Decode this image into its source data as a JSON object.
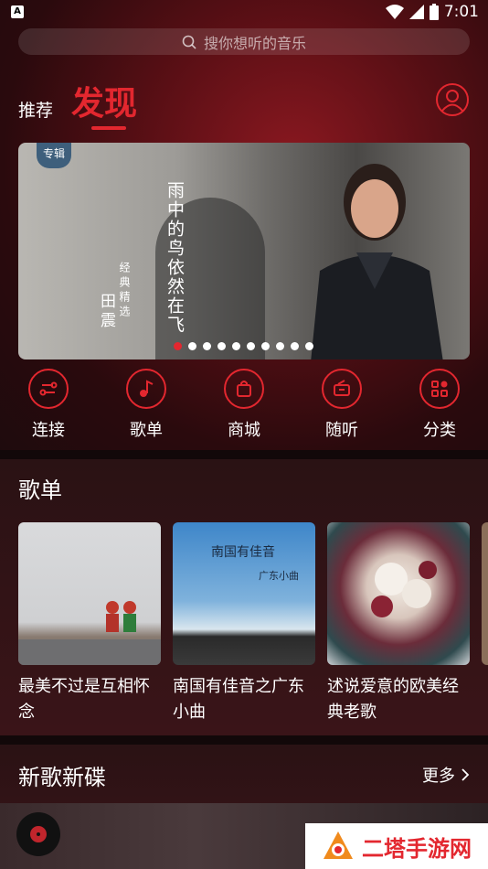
{
  "status_bar": {
    "time": "7:01"
  },
  "search": {
    "placeholder": "搜你想听的音乐"
  },
  "tabs": {
    "recommend": "推荐",
    "discover": "发现"
  },
  "banner": {
    "badge": "专辑",
    "title": "雨中的鸟依然在飞",
    "subtitle": "经典精选",
    "artist": "田震",
    "page_count": 10,
    "active_page": 1
  },
  "quick_actions": [
    {
      "label": "连接",
      "icon": "link-icon"
    },
    {
      "label": "歌单",
      "icon": "music-note-icon"
    },
    {
      "label": "商城",
      "icon": "shopping-bag-icon"
    },
    {
      "label": "随听",
      "icon": "radio-icon"
    },
    {
      "label": "分类",
      "icon": "category-grid-icon"
    }
  ],
  "playlists": {
    "title": "歌单",
    "items": [
      {
        "name": "最美不过是互相怀念"
      },
      {
        "name": "南国有佳音之广东小曲",
        "cover_text_main": "南国有佳音",
        "cover_text_small": "广东小曲"
      },
      {
        "name": "述说爱意的欧美经典老歌"
      }
    ]
  },
  "new_releases": {
    "title": "新歌新碟",
    "more": "更多"
  },
  "watermark": {
    "text": "二塔手游网"
  },
  "colors": {
    "accent": "#e3272f",
    "background": "#1a0d0e"
  }
}
